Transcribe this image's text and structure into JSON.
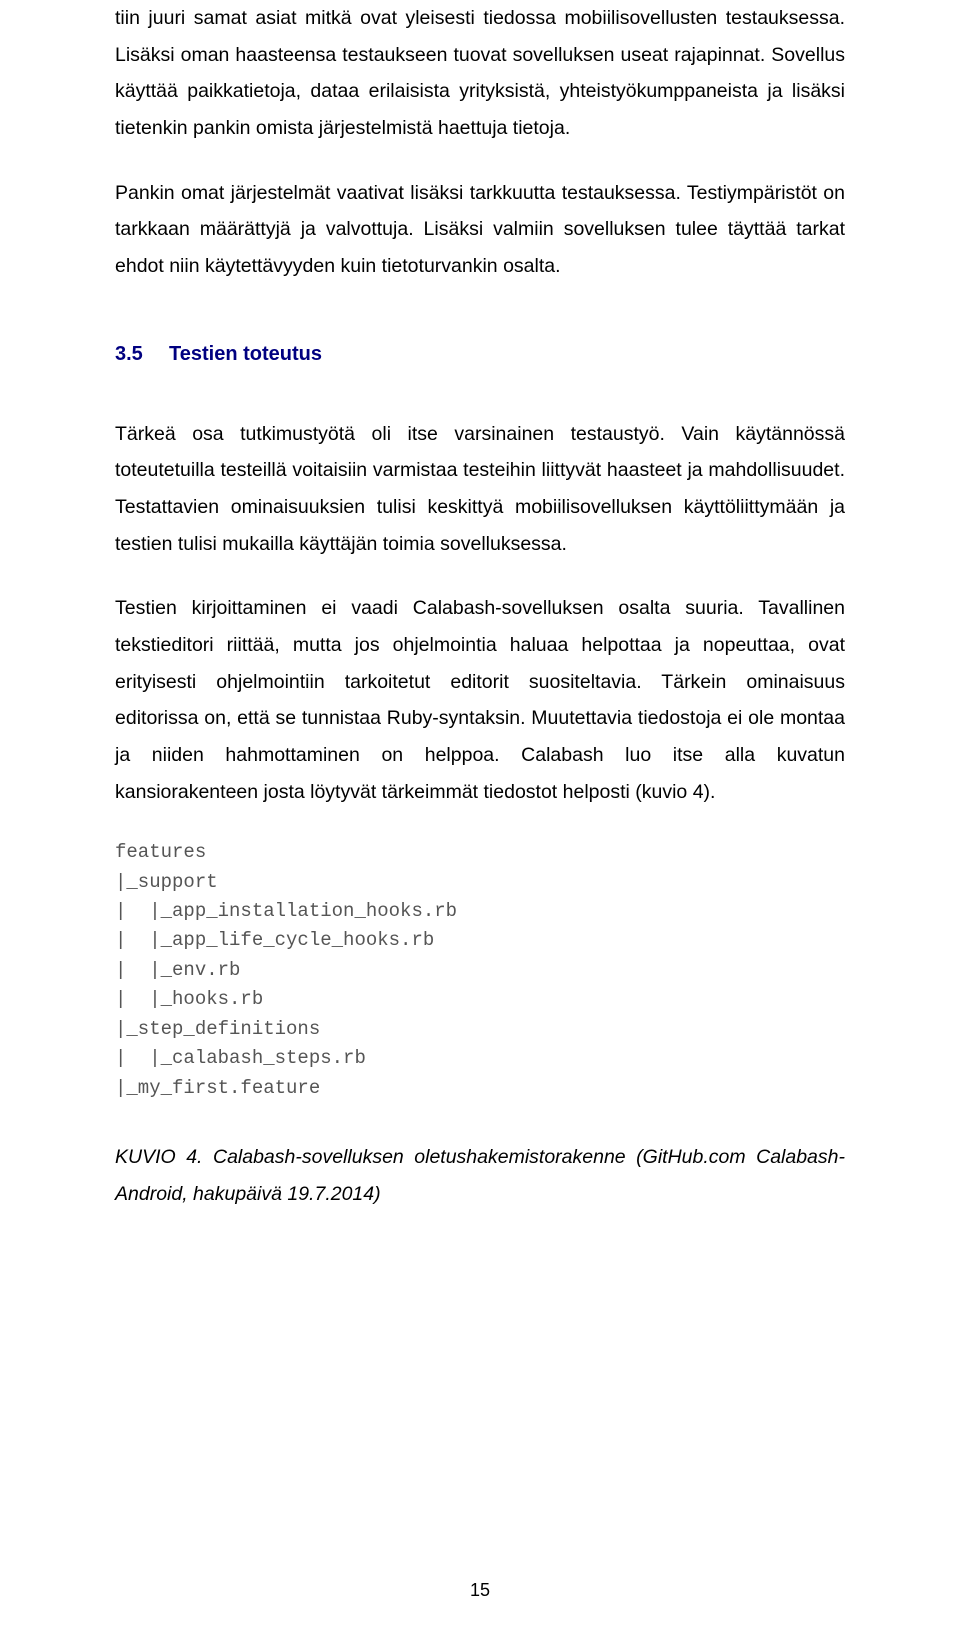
{
  "paragraphs": {
    "p1": "tiin juuri samat asiat mitkä ovat yleisesti tiedossa mobiilisovellusten testauksessa. Lisäksi oman haasteensa testaukseen tuovat sovelluksen useat rajapinnat. Sovellus käyttää paikkatietoja, dataa erilaisista yrityksistä, yhteistyökumppaneista ja lisäksi tietenkin pankin omista järjestelmistä haettuja tietoja.",
    "p2": "Pankin omat järjestelmät vaativat lisäksi tarkkuutta testauksessa. Testiympäristöt on tarkkaan määrättyjä ja valvottuja. Lisäksi valmiin sovelluksen tulee täyttää tarkat ehdot niin käytettävyyden kuin tietoturvankin osalta.",
    "p3": "Tärkeä osa tutkimustyötä oli itse varsinainen testaustyö. Vain käytännössä toteutetuilla testeillä voitaisiin varmistaa testeihin liittyvät haasteet ja mahdollisuudet. Testattavien ominaisuuksien tulisi keskittyä mobiilisovelluksen käyttöliittymään ja testien tulisi mukailla käyttäjän toimia sovelluksessa.",
    "p4": "Testien kirjoittaminen ei vaadi Calabash-sovelluksen osalta suuria. Tavallinen tekstieditori riittää, mutta jos ohjelmointia haluaa helpottaa ja nopeuttaa, ovat erityisesti ohjelmointiin tarkoitetut editorit suositeltavia. Tärkein ominaisuus editorissa on, että se tunnistaa Ruby-syntaksin. Muutettavia tiedostoja ei ole montaa ja niiden hahmottaminen on helppoa. Calabash luo itse alla kuvatun kansiorakenteen josta löytyvät tärkeimmät tiedostot helposti (kuvio 4)."
  },
  "section": {
    "number": "3.5",
    "title": "Testien toteutus"
  },
  "code": "features\n|_support\n|  |_app_installation_hooks.rb\n|  |_app_life_cycle_hooks.rb\n|  |_env.rb\n|  |_hooks.rb\n|_step_definitions\n|  |_calabash_steps.rb\n|_my_first.feature",
  "caption": {
    "label": "KUVIO 4.",
    "text": "Calabash-sovelluksen oletushakemistorakenne (GitHub.com Calabash-Android, hakupäivä 19.7.2014)"
  },
  "pageNumber": "15"
}
